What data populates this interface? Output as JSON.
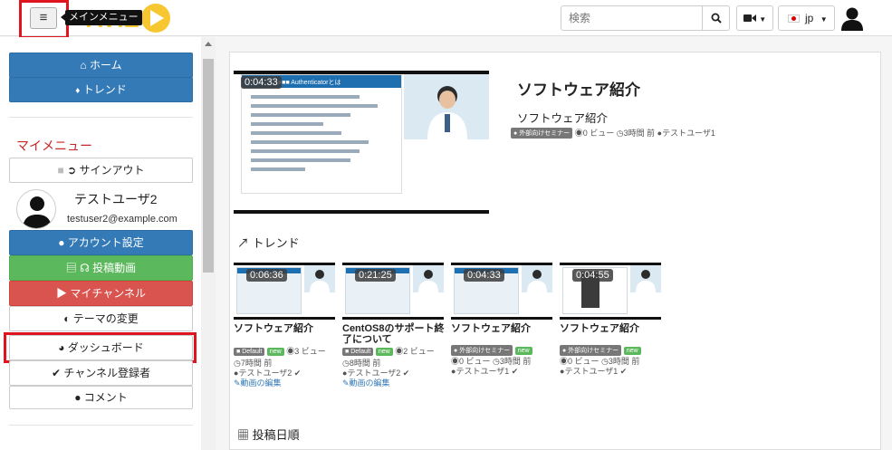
{
  "header": {
    "menu_tooltip": "メインメニュー",
    "logo_text": "AVIE",
    "search_placeholder": "検索",
    "lang": "jp",
    "menu_icon": "hamburger-icon",
    "colors": {
      "highlight": "#e0141e",
      "logo_yellow": "#f7c731",
      "logo_blue": "#4aa3df"
    }
  },
  "sidebar": {
    "home": "ホーム",
    "trend": "トレンド",
    "my_menu": "マイメニュー",
    "signout": "サインアウト",
    "user_name": "テストユーザ2",
    "user_email": "testuser2@example.com",
    "account": "アカウント設定",
    "upload": "投稿動画",
    "my_channel": "マイチャンネル",
    "theme": "テーマの変更",
    "dashboard": "ダッシュボード",
    "subscriptions": "チャンネル登録者",
    "comments": "コメント"
  },
  "featured": {
    "duration": "0:04:33",
    "title": "ソフトウェア紹介",
    "subtitle": "ソフトウェア紹介",
    "category": "外部向けセミナー",
    "views": "0 ビュー",
    "time": "3時間 前",
    "user": "テストユーザ1",
    "slide_title": "■■■ Authenticatorとは"
  },
  "trend_section": {
    "title": "トレンド"
  },
  "trend_cards": [
    {
      "duration": "0:06:36",
      "title": "ソフトウェア紹介",
      "category": "Default",
      "new": "new",
      "views": "3 ビュー",
      "time": "7時間 前",
      "user": "テストユーザ2",
      "edit": "動画の編集"
    },
    {
      "duration": "0:21:25",
      "title": "CentOS8のサポート終了について",
      "category": "Default",
      "new": "new",
      "views": "2 ビュー",
      "time": "8時間 前",
      "user": "テストユーザ2",
      "edit": "動画の編集"
    },
    {
      "duration": "0:04:33",
      "title": "ソフトウェア紹介",
      "category": "外部向けセミナー",
      "new": "new",
      "views": "0 ビュー",
      "time": "3時間 前",
      "user": "テストユーザ1"
    },
    {
      "duration": "0:04:55",
      "title": "ソフトウェア紹介",
      "category": "外部向けセミナー",
      "new": "new",
      "views": "0 ビュー",
      "time": "3時間 前",
      "user": "テストユーザ1"
    }
  ],
  "posted_section": {
    "title": "投稿日順"
  }
}
